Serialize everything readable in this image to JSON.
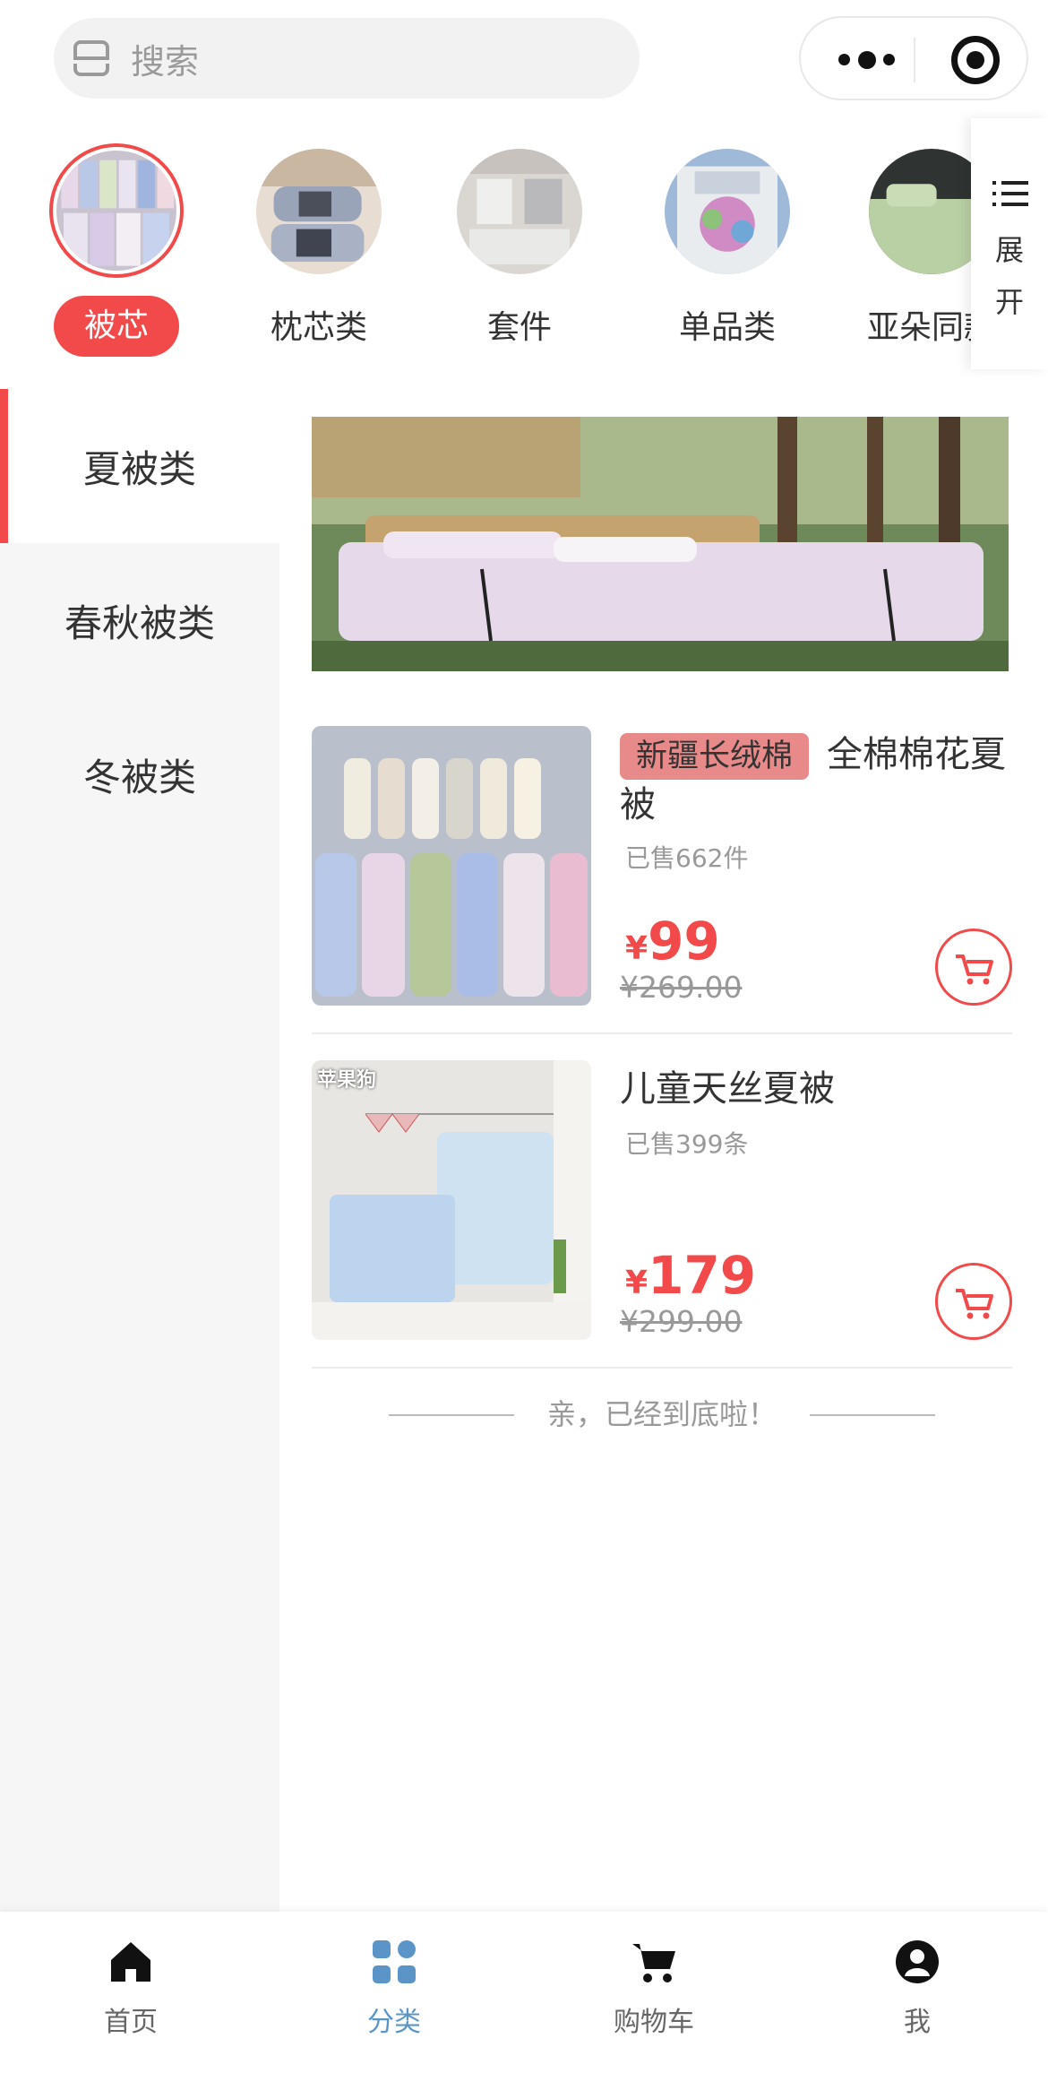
{
  "search": {
    "placeholder": "搜索"
  },
  "categories": [
    {
      "label": "被芯",
      "active": true
    },
    {
      "label": "枕芯类",
      "active": false
    },
    {
      "label": "套件",
      "active": false
    },
    {
      "label": "单品类",
      "active": false
    },
    {
      "label": "亚朵同款",
      "active": false
    }
  ],
  "expand": {
    "label_line1": "展",
    "label_line2": "开"
  },
  "side_menu": [
    {
      "label": "夏被类",
      "active": true
    },
    {
      "label": "春秋被类",
      "active": false
    },
    {
      "label": "冬被类",
      "active": false
    }
  ],
  "products": [
    {
      "tag": "新疆长绒棉",
      "title": "全棉棉花夏被",
      "sold": "已售662件",
      "price_symbol": "¥",
      "price": "99",
      "original_price": "¥269.00"
    },
    {
      "image_badge": "苹果狗",
      "title": "儿童天丝夏被",
      "sold": "已售399条",
      "price_symbol": "¥",
      "price": "179",
      "original_price": "¥299.00"
    }
  ],
  "end_text": "亲，已经到底啦！",
  "tabbar": [
    {
      "label": "首页",
      "icon": "home-icon",
      "active": false
    },
    {
      "label": "分类",
      "icon": "grid-icon",
      "active": true
    },
    {
      "label": "购物车",
      "icon": "cart-icon",
      "active": false
    },
    {
      "label": "我",
      "icon": "user-icon",
      "active": false
    }
  ],
  "colors": {
    "accent": "#f24a4a",
    "tab_active": "#5b95c7",
    "tag_bg": "#e98a8a"
  }
}
